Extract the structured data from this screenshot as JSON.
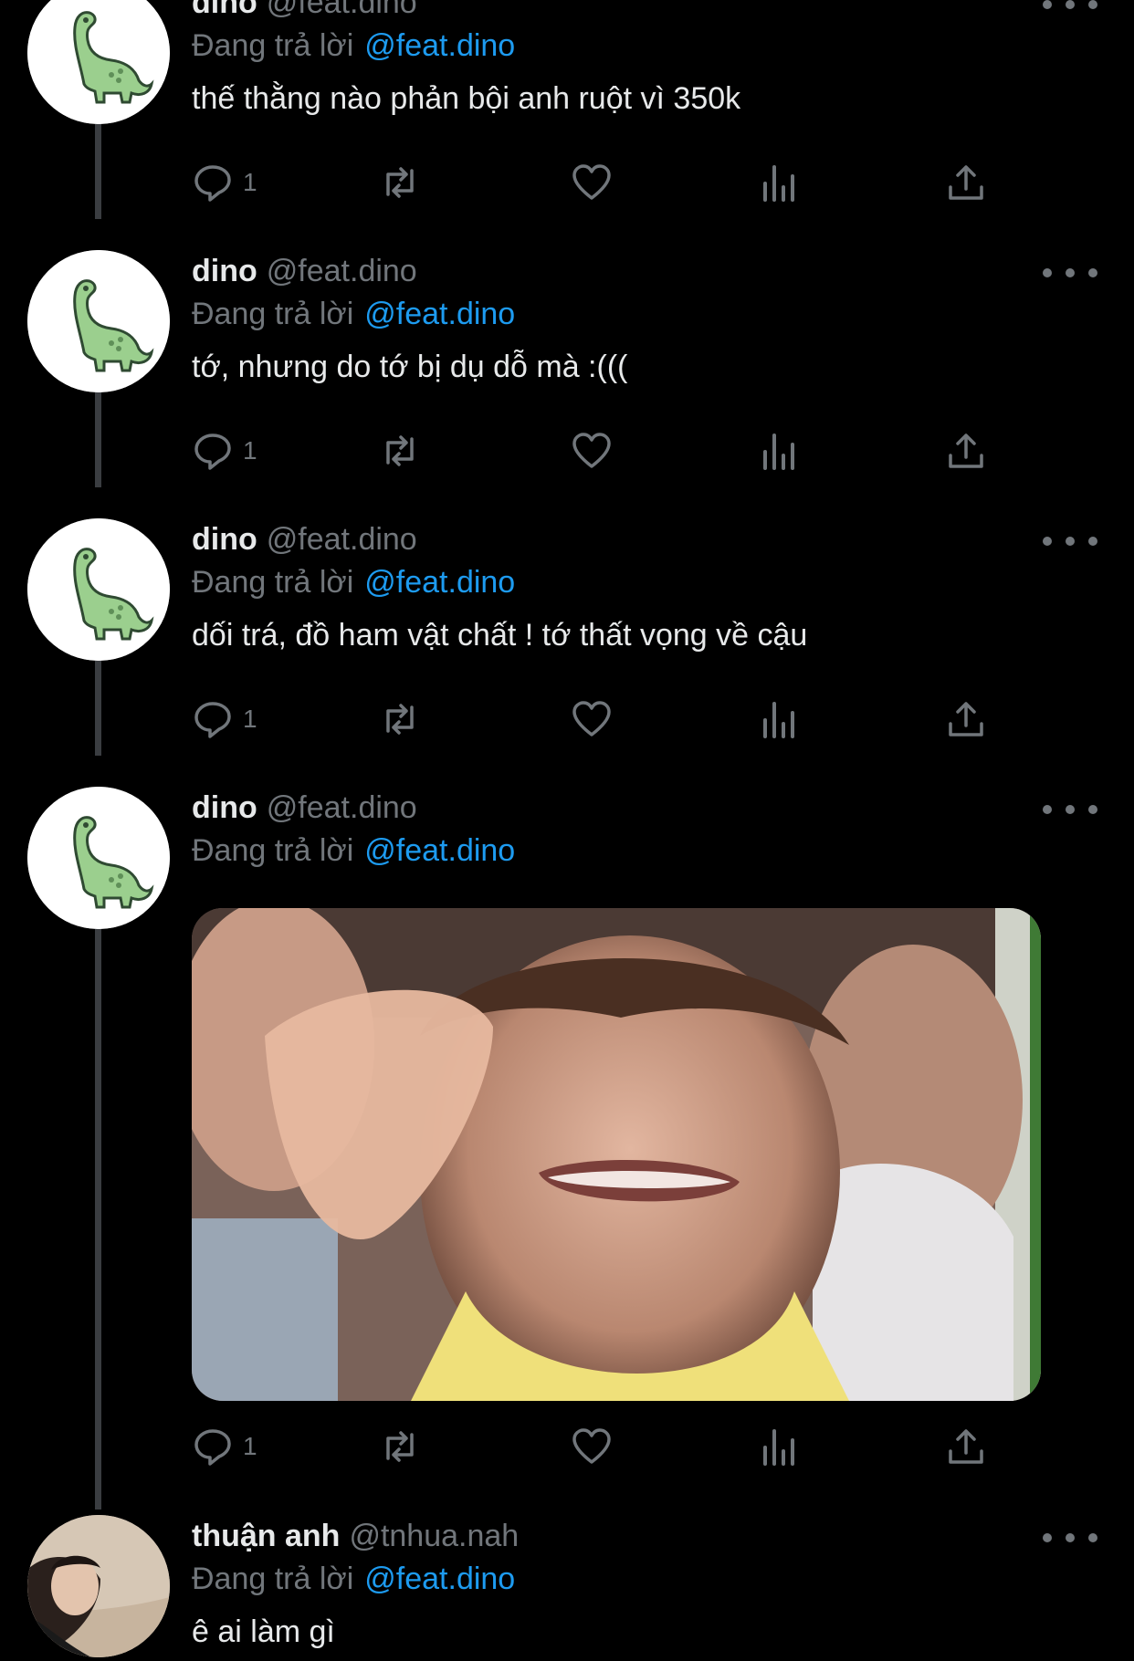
{
  "tweets": [
    {
      "name": "dino",
      "handle": "@feat.dino",
      "reply_prefix": "Đang trả lời",
      "reply_to": "@feat.dino",
      "text": "thế thằng nào phản bội anh ruột vì 350k",
      "reply_count": "1"
    },
    {
      "name": "dino",
      "handle": "@feat.dino",
      "reply_prefix": "Đang trả lời",
      "reply_to": "@feat.dino",
      "text": "tớ, nhưng do tớ bị dụ dỗ mà :(((",
      "reply_count": "1"
    },
    {
      "name": "dino",
      "handle": "@feat.dino",
      "reply_prefix": "Đang trả lời",
      "reply_to": "@feat.dino",
      "text": "dối trá, đồ ham vật chất ! tớ thất vọng về cậu",
      "reply_count": "1"
    },
    {
      "name": "dino",
      "handle": "@feat.dino",
      "reply_prefix": "Đang trả lời",
      "reply_to": "@feat.dino",
      "text": "",
      "reply_count": "1"
    },
    {
      "name": "thuận anh",
      "handle": "@tnhua.nah",
      "reply_prefix": "Đang trả lời",
      "reply_to": "@feat.dino",
      "text": "ê ai làm gì",
      "reply_count": ""
    }
  ],
  "icons": {
    "reply": "reply-icon",
    "retweet": "retweet-icon",
    "like": "heart-icon",
    "views": "views-icon",
    "share": "share-icon",
    "more": "more-icon"
  },
  "colors": {
    "background": "#000000",
    "mention": "#1d9bf0",
    "muted": "#71767b",
    "text": "#e7e9ea",
    "dino_green": "#9bcf8e"
  }
}
